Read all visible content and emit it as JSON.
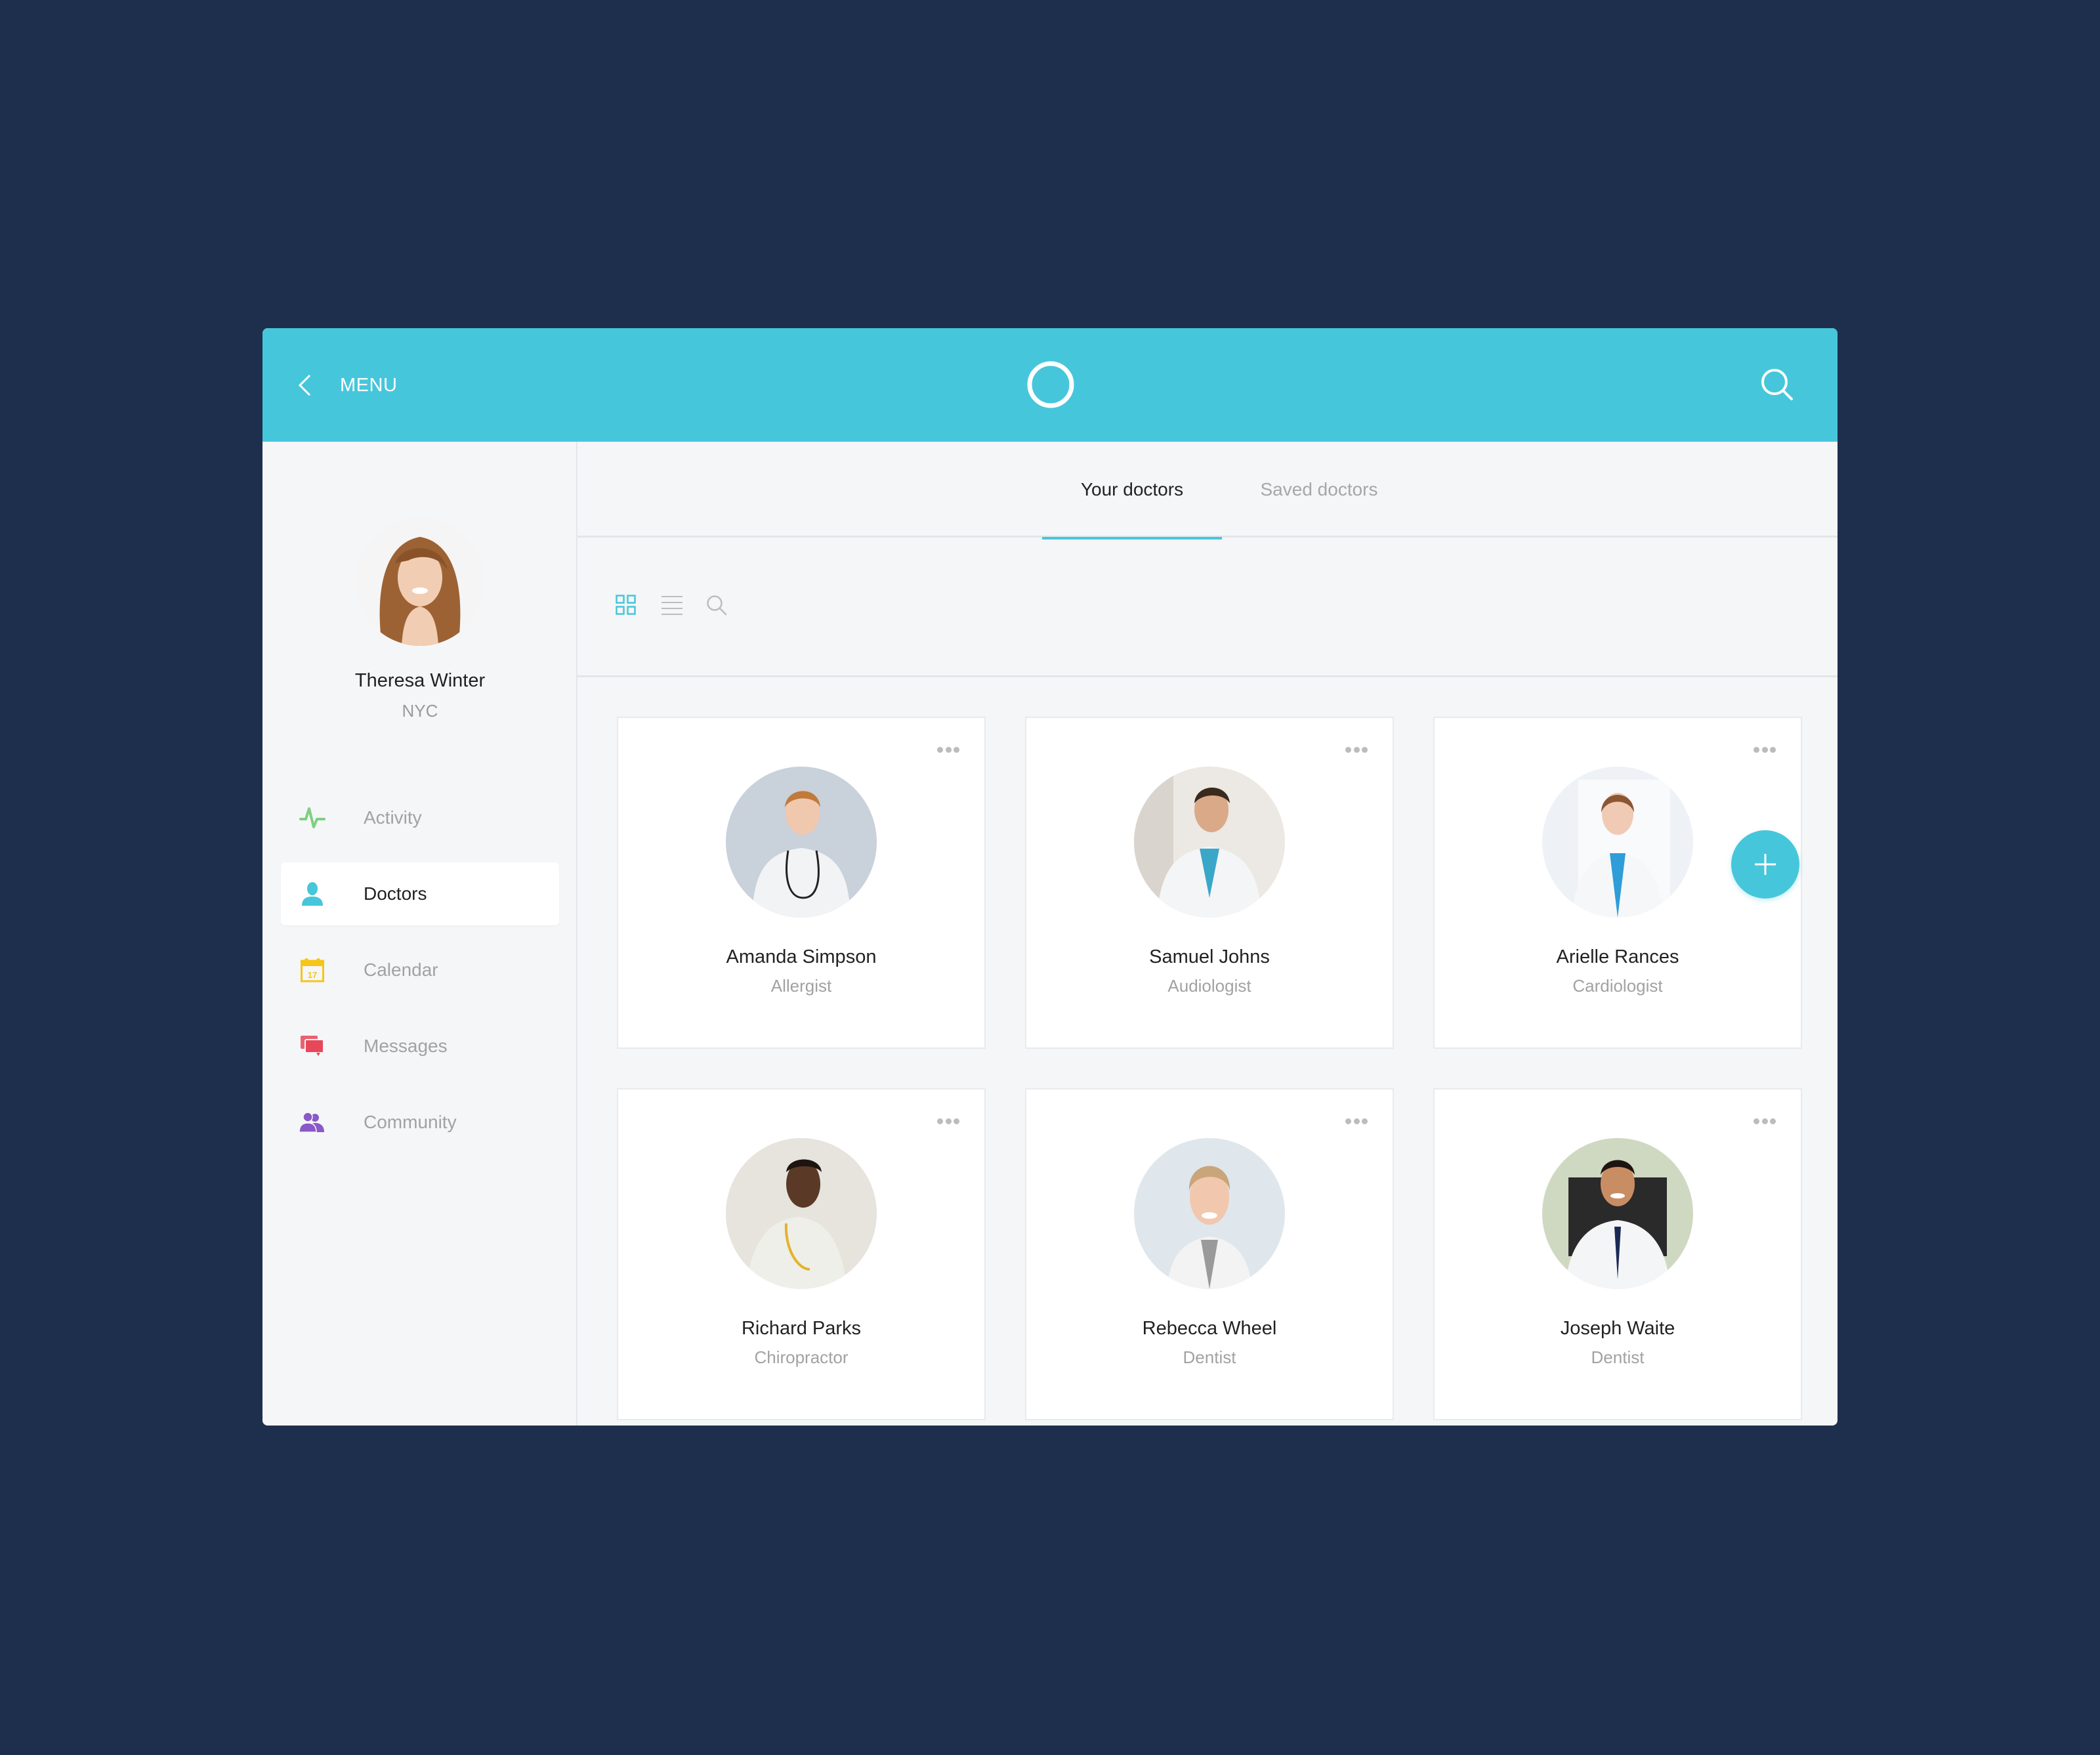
{
  "header": {
    "menu_label": "MENU",
    "back_icon": "chevron-left-icon",
    "logo_icon": "ring-logo-icon",
    "search_icon": "search-icon",
    "color": "#46c6db"
  },
  "profile": {
    "name": "Theresa Winter",
    "location": "NYC"
  },
  "sidebar": {
    "items": [
      {
        "label": "Activity",
        "icon": "activity-pulse-icon",
        "color": "#7fcf7f",
        "active": false
      },
      {
        "label": "Doctors",
        "icon": "person-icon",
        "color": "#46c6db",
        "active": true
      },
      {
        "label": "Calendar",
        "icon": "calendar-icon",
        "color": "#f5c518",
        "active": false,
        "icon_text": "17"
      },
      {
        "label": "Messages",
        "icon": "messages-icon",
        "color": "#e8475a",
        "active": false
      },
      {
        "label": "Community",
        "icon": "community-icon",
        "color": "#8a59c8",
        "active": false
      }
    ]
  },
  "tabs": [
    {
      "label": "Your doctors",
      "active": true
    },
    {
      "label": "Saved doctors",
      "active": false
    }
  ],
  "toolbar": {
    "grid_view_icon": "grid-view-icon",
    "list_view_icon": "list-view-icon",
    "search_icon": "search-icon",
    "active_view": "grid"
  },
  "add_button": {
    "icon": "plus-icon"
  },
  "doctors": [
    {
      "name": "Amanda Simpson",
      "specialty": "Allergist"
    },
    {
      "name": "Samuel Johns",
      "specialty": "Audiologist"
    },
    {
      "name": "Arielle Rances",
      "specialty": "Cardiologist"
    },
    {
      "name": "Richard Parks",
      "specialty": "Chiropractor"
    },
    {
      "name": "Rebecca Wheel",
      "specialty": "Dentist"
    },
    {
      "name": "Joseph Waite",
      "specialty": "Dentist"
    }
  ],
  "colors": {
    "background": "#1e2f4d",
    "accent": "#46c6db",
    "panel": "#f4f6f8"
  }
}
